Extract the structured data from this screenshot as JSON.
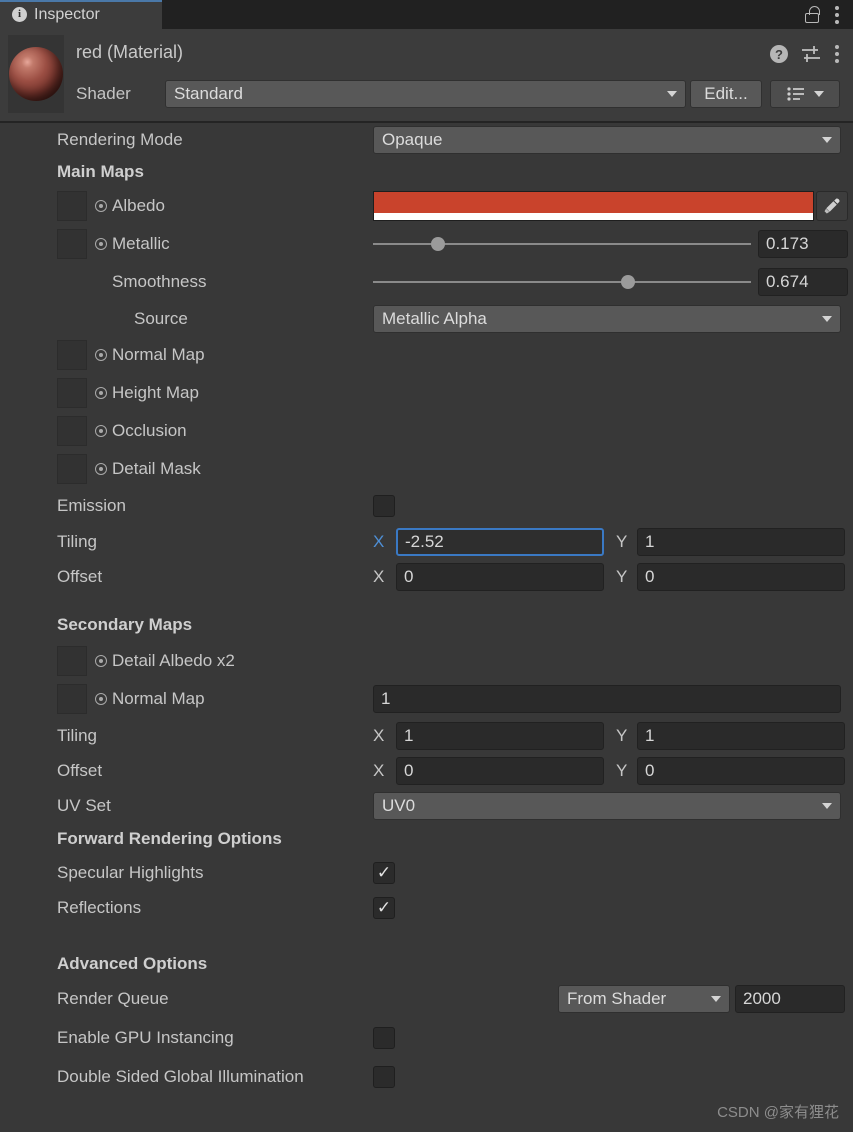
{
  "window": {
    "tab_label": "Inspector",
    "tab_icon": "info-icon",
    "lock_icon": "lock-open-icon",
    "menu_icon": "kebab-menu-icon"
  },
  "material": {
    "title": "red (Material)",
    "preview_icon": "material-sphere-preview",
    "help_icon": "help-icon",
    "preset_icon": "preset-settings-icon",
    "menu_icon": "kebab-menu-icon",
    "shader_label": "Shader",
    "shader_value": "Standard",
    "edit_label": "Edit...",
    "preset_button_icon": "preset-list-icon"
  },
  "rendering_mode": {
    "label": "Rendering Mode",
    "value": "Opaque"
  },
  "main_maps": {
    "header": "Main Maps",
    "albedo": {
      "label": "Albedo",
      "color": "#c9432c",
      "alpha_color": "#ffffff",
      "eyedropper_icon": "eyedropper-icon"
    },
    "metallic": {
      "label": "Metallic",
      "value": "0.173",
      "slider_pct": 17.3
    },
    "smoothness": {
      "label": "Smoothness",
      "value": "0.674",
      "slider_pct": 67.4
    },
    "source": {
      "label": "Source",
      "value": "Metallic Alpha"
    },
    "normal_map_label": "Normal Map",
    "height_map_label": "Height Map",
    "occlusion_label": "Occlusion",
    "detail_mask_label": "Detail Mask",
    "emission": {
      "label": "Emission",
      "checked": false
    },
    "tiling": {
      "label": "Tiling",
      "x_axis": "X",
      "x_value": "-2.52",
      "x_focused": true,
      "y_axis": "Y",
      "y_value": "1"
    },
    "offset": {
      "label": "Offset",
      "x_axis": "X",
      "x_value": "0",
      "y_axis": "Y",
      "y_value": "0"
    }
  },
  "secondary_maps": {
    "header": "Secondary Maps",
    "detail_albedo_label": "Detail Albedo x2",
    "normal_map_label": "Normal Map",
    "normal_map_value": "1",
    "tiling": {
      "label": "Tiling",
      "x_axis": "X",
      "x_value": "1",
      "y_axis": "Y",
      "y_value": "1"
    },
    "offset": {
      "label": "Offset",
      "x_axis": "X",
      "x_value": "0",
      "y_axis": "Y",
      "y_value": "0"
    },
    "uv_set": {
      "label": "UV Set",
      "value": "UV0"
    }
  },
  "forward_rendering": {
    "header": "Forward Rendering Options",
    "specular_highlights": {
      "label": "Specular Highlights",
      "checked": true,
      "mark": "✓"
    },
    "reflections": {
      "label": "Reflections",
      "checked": true,
      "mark": "✓"
    }
  },
  "advanced": {
    "header": "Advanced Options",
    "render_queue": {
      "label": "Render Queue",
      "mode": "From Shader",
      "value": "2000"
    },
    "gpu_instancing": {
      "label": "Enable GPU Instancing",
      "checked": false
    },
    "double_sided_gi": {
      "label": "Double Sided Global Illumination",
      "checked": false
    }
  },
  "watermark": "CSDN @家有狸花",
  "colors": {
    "panel_bg": "#383838",
    "header_bg": "#3c3c3c",
    "tabbar_bg": "#212121",
    "accent_blue": "#3a79c4",
    "albedo_red": "#c9432c"
  }
}
